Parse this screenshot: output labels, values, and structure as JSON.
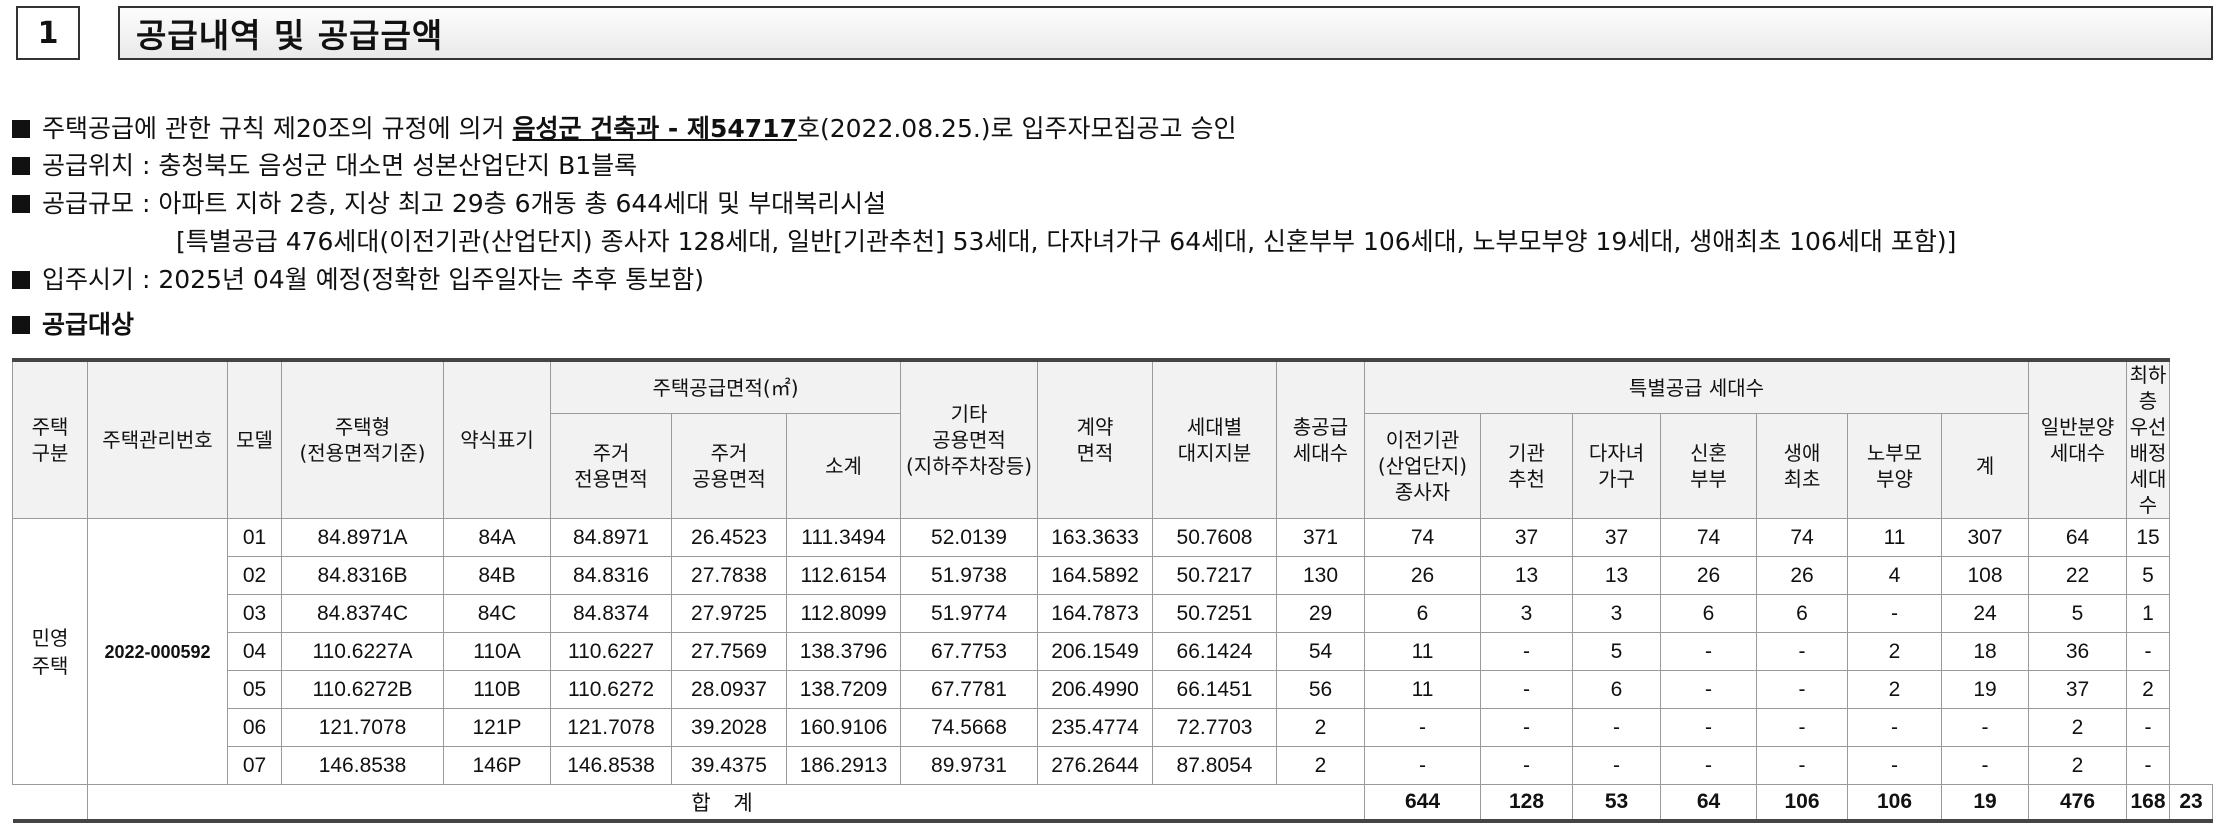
{
  "section": {
    "number": "1",
    "title": "공급내역 및 공급금액"
  },
  "info": {
    "line1_pre": "주택공급에 관한 규칙 제20조의 규정에 의거 ",
    "line1_bold": "음성군 건축과 - 제54717",
    "line1_post": "호(2022.08.25.)로 입주자모집공고 승인",
    "line2": "공급위치 : 충청북도 음성군 대소면 성본산업단지 B1블록",
    "line3": "공급규모 : 아파트 지하 2층, 지상 최고 29층 6개동 총 644세대 및 부대복리시설",
    "line4": "[특별공급 476세대(이전기관(산업단지) 종사자 128세대, 일반[기관추천] 53세대, 다자녀가구 64세대, 신혼부부 106세대, 노부모부양 19세대, 생애최초 106세대 포함)]",
    "line5": "입주시기 : 2025년 04월 예정(정확한 입주일자는 추후 통보함)",
    "line6": "공급대상"
  },
  "table": {
    "headers": {
      "housing_type": "주택\n구분",
      "mgmt_no": "주택관리번호",
      "model": "모델",
      "housing_form": "주택형\n(전용면적기준)",
      "abbrev": "약식표기",
      "supply_area": "주택공급면적(㎡)",
      "exclusive": "주거\n전용면적",
      "common": "주거\n공용면적",
      "subtotal": "소계",
      "other_common": "기타\n공용면적\n(지하주차장등)",
      "contract_area": "계약\n면적",
      "land_share": "세대별\n대지지분",
      "total_households": "총공급\n세대수",
      "special": "특별공급 세대수",
      "relocated": "이전기관\n(산업단지)\n종사자",
      "institution": "기관\n추천",
      "multi_child": "다자녀\n가구",
      "newlywed": "신혼\n부부",
      "first_life": "생애\n최초",
      "elderly_parent": "노부모\n부양",
      "special_total": "계",
      "general": "일반분양\n세대수",
      "lowest_floor": "최하층\n우선배정\n세대수"
    },
    "row_label": "민영\n주택",
    "mgmt_number": "2022-000592",
    "rows": [
      [
        "01",
        "84.8971A",
        "84A",
        "84.8971",
        "26.4523",
        "111.3494",
        "52.0139",
        "163.3633",
        "50.7608",
        "371",
        "74",
        "37",
        "37",
        "74",
        "74",
        "11",
        "307",
        "64",
        "15"
      ],
      [
        "02",
        "84.8316B",
        "84B",
        "84.8316",
        "27.7838",
        "112.6154",
        "51.9738",
        "164.5892",
        "50.7217",
        "130",
        "26",
        "13",
        "13",
        "26",
        "26",
        "4",
        "108",
        "22",
        "5"
      ],
      [
        "03",
        "84.8374C",
        "84C",
        "84.8374",
        "27.9725",
        "112.8099",
        "51.9774",
        "164.7873",
        "50.7251",
        "29",
        "6",
        "3",
        "3",
        "6",
        "6",
        "-",
        "24",
        "5",
        "1"
      ],
      [
        "04",
        "110.6227A",
        "110A",
        "110.6227",
        "27.7569",
        "138.3796",
        "67.7753",
        "206.1549",
        "66.1424",
        "54",
        "11",
        "-",
        "5",
        "-",
        "-",
        "2",
        "18",
        "36",
        "-"
      ],
      [
        "05",
        "110.6272B",
        "110B",
        "110.6272",
        "28.0937",
        "138.7209",
        "67.7781",
        "206.4990",
        "66.1451",
        "56",
        "11",
        "-",
        "6",
        "-",
        "-",
        "2",
        "19",
        "37",
        "2"
      ],
      [
        "06",
        "121.7078",
        "121P",
        "121.7078",
        "39.2028",
        "160.9106",
        "74.5668",
        "235.4774",
        "72.7703",
        "2",
        "-",
        "-",
        "-",
        "-",
        "-",
        "-",
        "-",
        "2",
        "-"
      ],
      [
        "07",
        "146.8538",
        "146P",
        "146.8538",
        "39.4375",
        "186.2913",
        "89.9731",
        "276.2644",
        "87.8054",
        "2",
        "-",
        "-",
        "-",
        "-",
        "-",
        "-",
        "-",
        "2",
        "-"
      ]
    ],
    "total_label": "합 계",
    "totals": [
      "644",
      "128",
      "53",
      "64",
      "106",
      "106",
      "19",
      "476",
      "168",
      "23"
    ]
  }
}
